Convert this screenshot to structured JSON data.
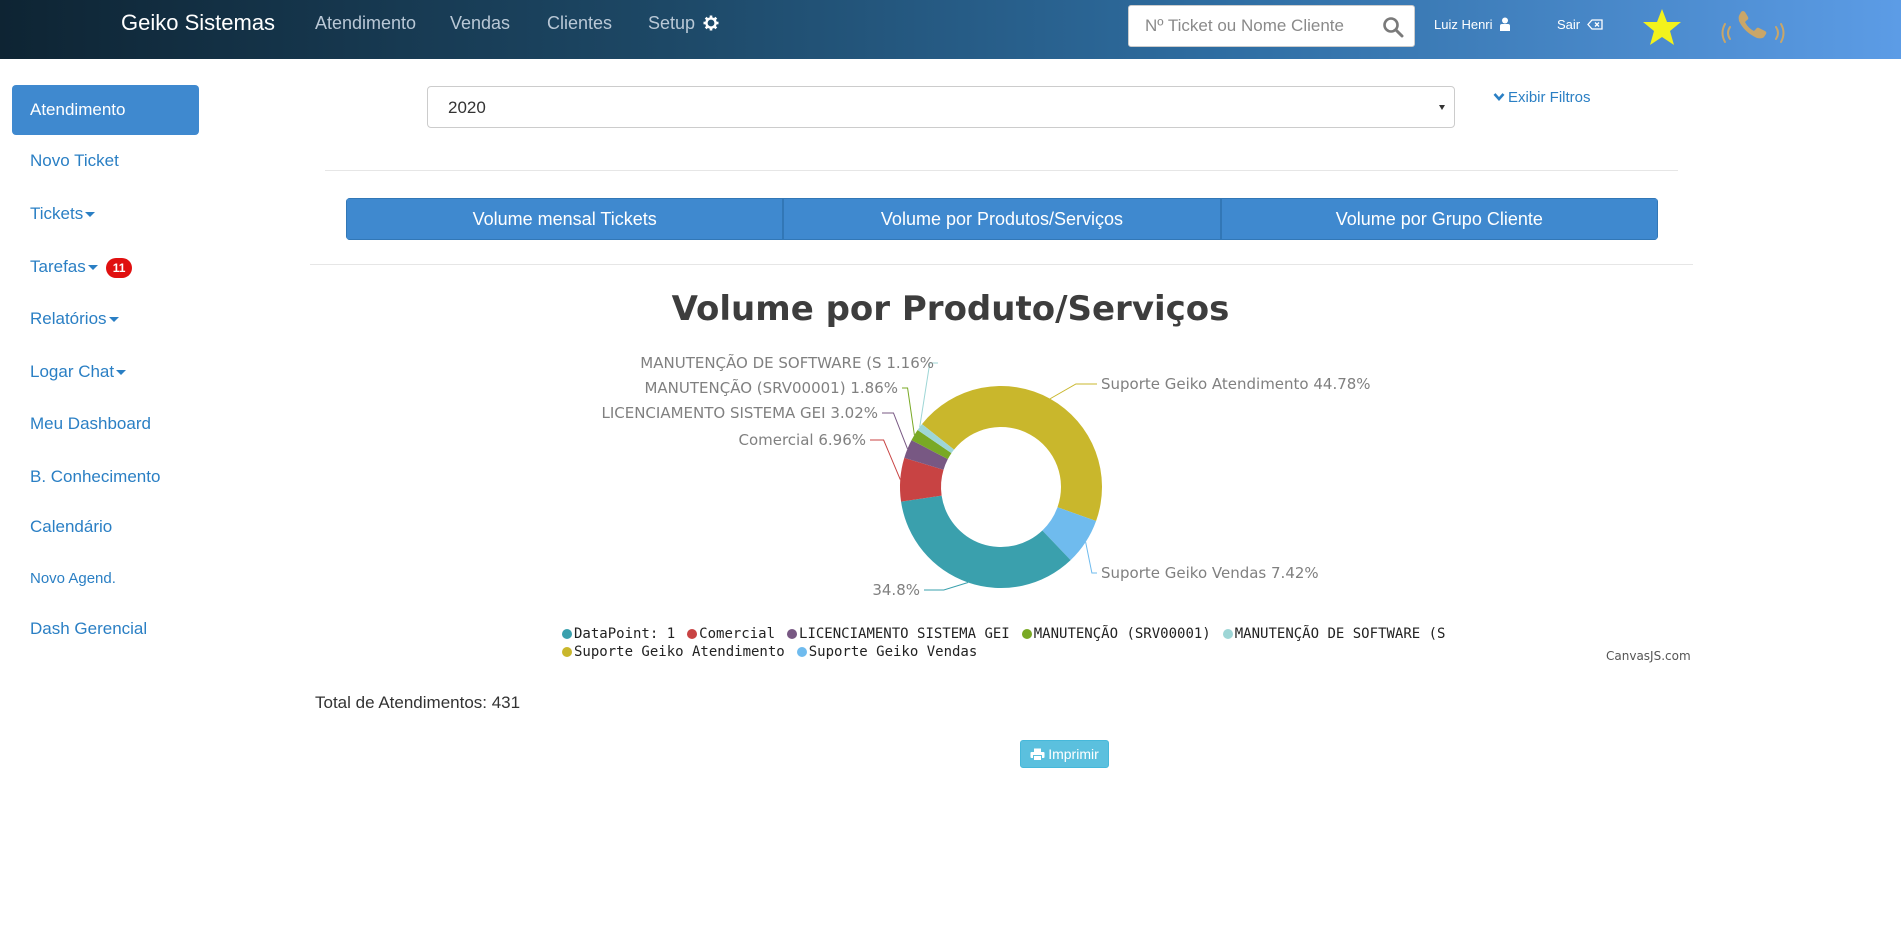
{
  "header": {
    "brand": "Geiko Sistemas",
    "nav": [
      "Atendimento",
      "Vendas",
      "Clientes",
      "Setup"
    ],
    "search_placeholder": "Nº Ticket ou Nome Cliente",
    "user_label": "Luiz Henri",
    "exit_label": "Sair"
  },
  "sidebar": {
    "items": [
      {
        "label": "Atendimento",
        "active": true
      },
      {
        "label": "Novo Ticket"
      },
      {
        "label": "Tickets",
        "dropdown": true
      },
      {
        "label": "Tarefas",
        "dropdown": true,
        "badge": "11"
      },
      {
        "label": "Relatórios",
        "dropdown": true
      },
      {
        "label": "Logar Chat",
        "dropdown": true
      },
      {
        "label": "Meu Dashboard"
      },
      {
        "label": "B. Conhecimento"
      },
      {
        "label": "Calendário"
      },
      {
        "label": "Novo Agend."
      },
      {
        "label": "Dash Gerencial"
      }
    ]
  },
  "filters": {
    "year_value": "2020",
    "show_filters_label": "Exibir Filtros"
  },
  "tabs": [
    "Volume mensal Tickets",
    "Volume por Produtos/Serviços",
    "Volume por Grupo Cliente"
  ],
  "chart_data": {
    "type": "pie",
    "title": "Volume por Produto/Serviços",
    "slices": [
      {
        "name": "DataPoint: 1",
        "percent": 34.8,
        "label": "34.8%",
        "color": "#3aa0ad"
      },
      {
        "name": "Comercial",
        "percent": 6.96,
        "label": "Comercial 6.96%",
        "color": "#c84343"
      },
      {
        "name": "LICENCIAMENTO SISTEMA GEI",
        "percent": 3.02,
        "label": "LICENCIAMENTO SISTEMA GEI 3.02%",
        "color": "#785883"
      },
      {
        "name": "MANUTENÇÃO (SRV00001)",
        "percent": 1.86,
        "label": "MANUTENÇÃO (SRV00001) 1.86%",
        "color": "#79a925"
      },
      {
        "name": "MANUTENÇÃO DE SOFTWARE (S",
        "percent": 1.16,
        "label": "MANUTENÇÃO DE SOFTWARE (S 1.16%",
        "color": "#9ed6d6"
      },
      {
        "name": "Suporte Geiko Atendimento",
        "percent": 44.78,
        "label": "Suporte Geiko Atendimento 44.78%",
        "color": "#c9b72c"
      },
      {
        "name": "Suporte Geiko Vendas",
        "percent": 7.42,
        "label": "Suporte Geiko Vendas 7.42%",
        "color": "#6fbbee"
      }
    ],
    "legend": [
      "DataPoint: 1",
      "Comercial",
      "LICENCIAMENTO SISTEMA GEI",
      "MANUTENÇÃO (SRV00001)",
      "MANUTENÇÃO DE SOFTWARE (S",
      "Suporte Geiko Atendimento",
      "Suporte Geiko Vendas"
    ],
    "legend_position": "bottom"
  },
  "credit": "CanvasJS.com",
  "total_label": "Total de Atendimentos: 431",
  "print_label": "Imprimir"
}
